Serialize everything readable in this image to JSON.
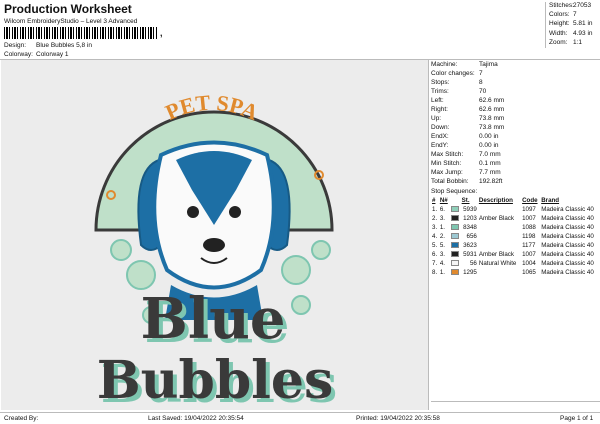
{
  "header": {
    "title": "Production Worksheet",
    "subtitle": "Wilcom EmbroideryStudio – Level 3 Advanced",
    "barcode_mark": ",",
    "design_label": "Design:",
    "design_value": "Blue Bubbles 5,8 in",
    "colorway_label": "Colorway:",
    "colorway_value": "Colorway 1"
  },
  "summary": [
    {
      "k": "Stitches:",
      "v": "27053"
    },
    {
      "k": "Colors:",
      "v": "7"
    },
    {
      "k": "Height:",
      "v": "5.81 in"
    },
    {
      "k": "Width:",
      "v": "4.93 in"
    },
    {
      "k": "Zoom:",
      "v": "1:1"
    }
  ],
  "machine_info": [
    {
      "k": "Machine:",
      "v": "Tajima"
    },
    {
      "k": "Color changes:",
      "v": "7"
    },
    {
      "k": "Stops:",
      "v": "8"
    },
    {
      "k": "Trims:",
      "v": "70"
    },
    {
      "k": "Left:",
      "v": "62.6 mm"
    },
    {
      "k": "Right:",
      "v": "62.6 mm"
    },
    {
      "k": "Up:",
      "v": "73.8 mm"
    },
    {
      "k": "Down:",
      "v": "73.8 mm"
    },
    {
      "k": "EndX:",
      "v": "0.00 in"
    },
    {
      "k": "EndY:",
      "v": "0.00 in"
    },
    {
      "k": "Max Stitch:",
      "v": "7.0 mm"
    },
    {
      "k": "Min Stitch:",
      "v": "0.1 mm"
    },
    {
      "k": "Max Jump:",
      "v": "7.7 mm"
    },
    {
      "k": "Total Bobbin:",
      "v": "192.82ft"
    }
  ],
  "stop_sequence": {
    "title": "Stop Sequence:",
    "headers": [
      "#",
      "N#",
      "",
      "St.",
      "Description",
      "Code",
      "Brand"
    ],
    "rows": [
      {
        "n": "1.",
        "c": "6.",
        "color": "#8fcfb9",
        "st": "5939",
        "desc": "",
        "code": "1097",
        "brand": "Madeira Classic 40"
      },
      {
        "n": "2.",
        "c": "3.",
        "color": "#222222",
        "st": "1203",
        "desc": "Amber Black",
        "code": "1007",
        "brand": "Madeira Classic 40"
      },
      {
        "n": "3.",
        "c": "1.",
        "color": "#7ec6b0",
        "st": "8348",
        "desc": "",
        "code": "1088",
        "brand": "Madeira Classic 40"
      },
      {
        "n": "4.",
        "c": "2.",
        "color": "#9dc9d3",
        "st": "656",
        "desc": "",
        "code": "1198",
        "brand": "Madeira Classic 40"
      },
      {
        "n": "5.",
        "c": "5.",
        "color": "#1d6fa5",
        "st": "3623",
        "desc": "",
        "code": "1177",
        "brand": "Madeira Classic 40"
      },
      {
        "n": "6.",
        "c": "3.",
        "color": "#222222",
        "st": "5931",
        "desc": "Amber Black",
        "code": "1007",
        "brand": "Madeira Classic 40"
      },
      {
        "n": "7.",
        "c": "4.",
        "color": "#f5f5f5",
        "st": "56",
        "desc": "Natural White",
        "code": "1004",
        "brand": "Madeira Classic 40"
      },
      {
        "n": "8.",
        "c": "1.",
        "color": "#e08a2e",
        "st": "1295",
        "desc": "",
        "code": "1065",
        "brand": "Madeira Classic 40"
      }
    ]
  },
  "design": {
    "arc_text": "PET SPA",
    "line1": "Blue",
    "line2": "Bubbles",
    "colors": {
      "mint": "#bfe0c9",
      "teal": "#7ec6b0",
      "blue": "#1d6fa5",
      "orange": "#e08a2e",
      "dark": "#3a3a3a",
      "white": "#fafafa"
    }
  },
  "footer": {
    "created": "Created By:",
    "saved": "Last Saved: 19/04/2022 20:35:54",
    "printed": "Printed: 19/04/2022 20:35:58",
    "page": "Page 1 of 1"
  }
}
